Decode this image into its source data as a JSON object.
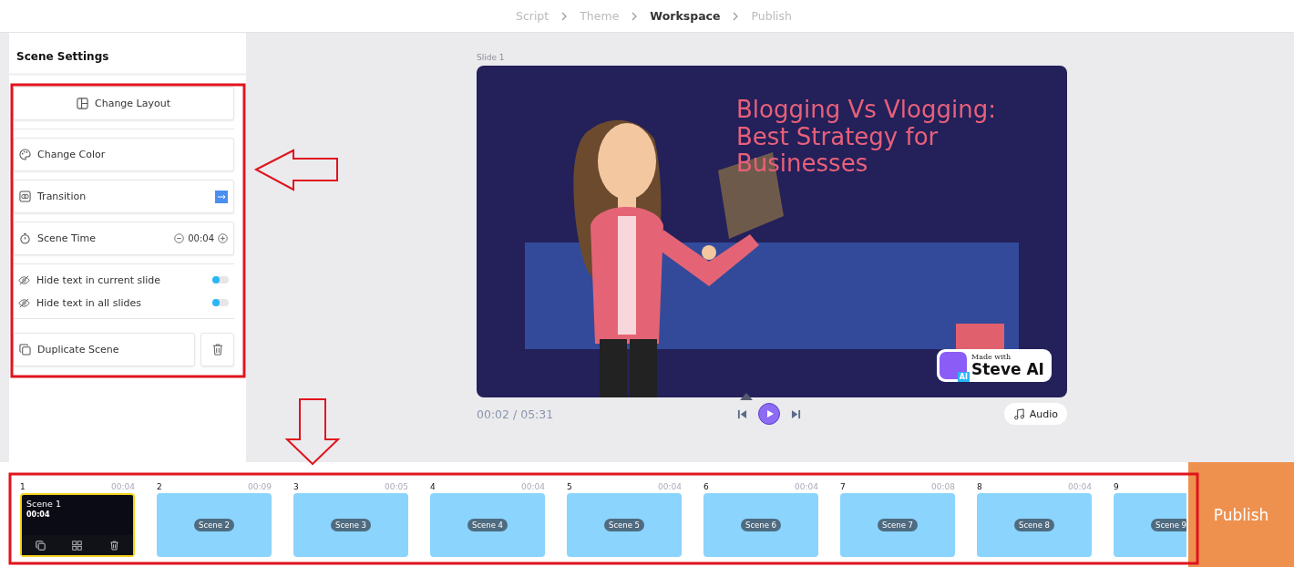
{
  "steps": [
    {
      "label": "Script",
      "selected": false
    },
    {
      "label": "Theme",
      "selected": false
    },
    {
      "label": "Workspace",
      "selected": true
    },
    {
      "label": "Publish",
      "selected": false
    }
  ],
  "sidebar": {
    "title": "Scene Settings",
    "change_layout": "Change Layout",
    "change_color": "Change Color",
    "transition": "Transition",
    "scene_time": {
      "label": "Scene Time",
      "value": "00:04"
    },
    "toggles": [
      {
        "label": "Hide text in current slide",
        "on": false
      },
      {
        "label": "Hide text in all slides",
        "on": false
      }
    ],
    "duplicate": "Duplicate Scene"
  },
  "preview": {
    "slide_label": "Slide 1",
    "title_lines": [
      "Blogging Vs Vlogging:",
      "Best Strategy for",
      "Businesses"
    ],
    "badge": {
      "caption": "Made with",
      "brand": "Steve AI",
      "logo_text": "AI"
    }
  },
  "player": {
    "time": "00:02 / 05:31",
    "audio": "Audio"
  },
  "timeline": {
    "scenes": [
      {
        "number": "1",
        "duration": "00:04",
        "label": "Scene 1",
        "time": "00:04",
        "selected": true
      },
      {
        "number": "2",
        "duration": "00:09",
        "label": "Scene 2",
        "selected": false
      },
      {
        "number": "3",
        "duration": "00:05",
        "label": "Scene 3",
        "selected": false
      },
      {
        "number": "4",
        "duration": "00:04",
        "label": "Scene 4",
        "selected": false
      },
      {
        "number": "5",
        "duration": "00:04",
        "label": "Scene 5",
        "selected": false
      },
      {
        "number": "6",
        "duration": "00:04",
        "label": "Scene 6",
        "selected": false
      },
      {
        "number": "7",
        "duration": "00:08",
        "label": "Scene 7",
        "selected": false
      },
      {
        "number": "8",
        "duration": "00:04",
        "label": "Scene 8",
        "selected": false
      },
      {
        "number": "9",
        "label": "Scene 9",
        "selected": false
      }
    ]
  },
  "publish": "Publish"
}
